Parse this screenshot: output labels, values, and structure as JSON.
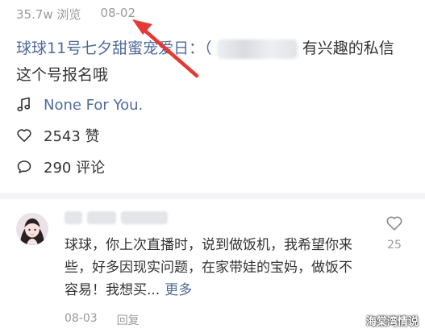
{
  "post": {
    "views": "35.7w 浏览",
    "date": "08-02",
    "caption_topic": "球球11号七夕甜蜜宠爱日：（",
    "caption_rest": "有兴趣的私信这个号报名哦"
  },
  "music": {
    "title": "None For You.",
    "icon": "music-note-icon"
  },
  "likes": {
    "label": "2543 赞",
    "icon": "heart-outline-icon"
  },
  "comments": {
    "label": "290 评论",
    "icon": "comment-bubble-icon"
  },
  "comment": {
    "text": "球球，你上次直播时，说到做饭机，我希望你来些，好多因现实问题，在家带娃的宝妈，做饭不容易！我想买...",
    "more": "更多",
    "like_count": "25",
    "date": "08-03",
    "reply": "回复"
  },
  "watermark": "海棠湾情说",
  "colors": {
    "link": "#506b9b",
    "muted": "#9a9a9a",
    "text": "#333333",
    "annotation_arrow": "#e53935"
  }
}
